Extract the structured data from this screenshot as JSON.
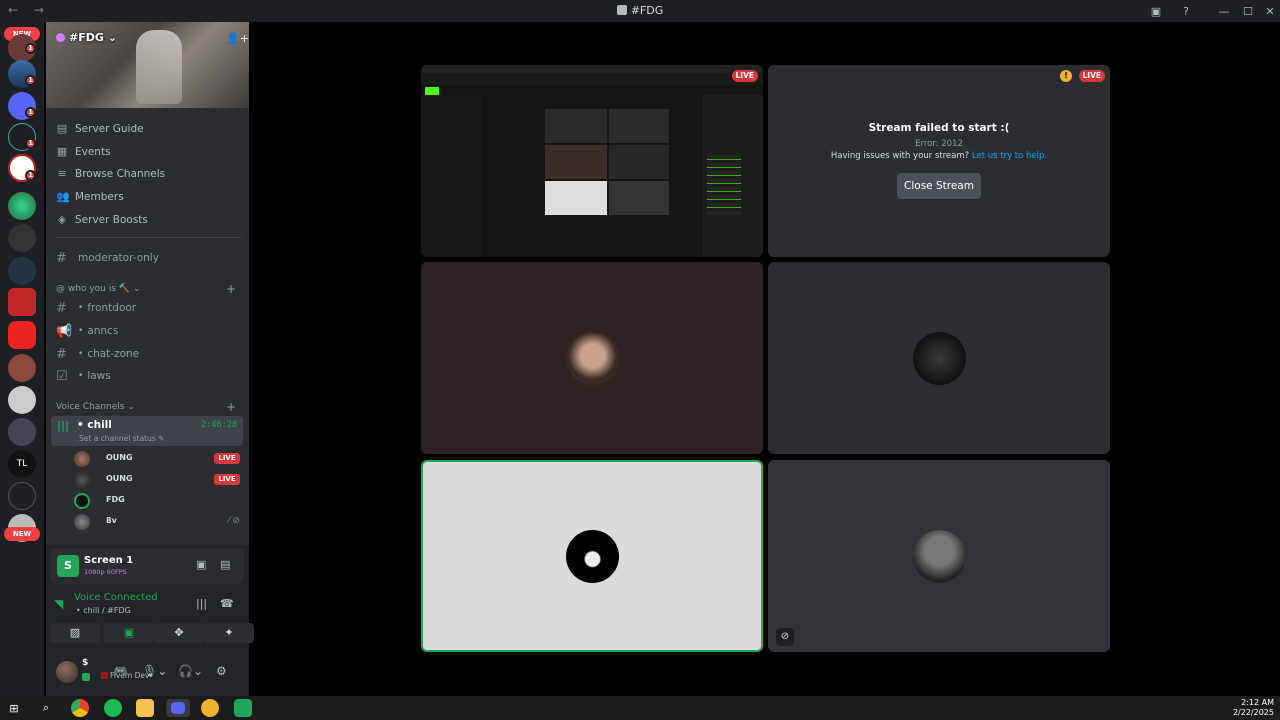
{
  "window": {
    "title": "#FDG"
  },
  "server": {
    "name": "#FDG"
  },
  "rail": {
    "new_top": "NEW",
    "new_bottom": "NEW",
    "badge": "1"
  },
  "nav": [
    {
      "label": "Server Guide",
      "icon": "guide-icon"
    },
    {
      "label": "Events",
      "icon": "calendar-icon"
    },
    {
      "label": "Browse Channels",
      "icon": "browse-icon"
    },
    {
      "label": "Members",
      "icon": "members-icon"
    },
    {
      "label": "Server Boosts",
      "icon": "boost-icon"
    }
  ],
  "moderator_channel": "moderator-only",
  "category_1": "@ who you is 🔨",
  "text_channels": [
    "frontdoor",
    "anncs",
    "chat-zone",
    "laws"
  ],
  "category_2": "Voice Channels",
  "voice_channel": {
    "name": "chill",
    "timer": "2:46:28",
    "status": "Set a channel status"
  },
  "voice_users": [
    {
      "name": "OUNG",
      "live": "LIVE"
    },
    {
      "name": "OUNG",
      "live": "LIVE"
    },
    {
      "name": "FDG",
      "live": ""
    },
    {
      "name": "8v",
      "live": ""
    }
  ],
  "screen_panel": {
    "title": "Screen 1",
    "subtitle": "1080p 60FPS"
  },
  "voice_connected": {
    "title": "Voice Connected",
    "subtitle": "chill / #FDG"
  },
  "user": {
    "activity": "Fivem Dev"
  },
  "streams": {
    "live_label": "LIVE",
    "failed_title": "Stream failed to start :(",
    "failed_error": "Error: 2012",
    "failed_help_prefix": "Having issues with your stream?",
    "failed_help_link": "Let us try to help.",
    "close_button": "Close Stream"
  },
  "clock": {
    "time": "2:12 AM",
    "date": "2/22/2025"
  }
}
